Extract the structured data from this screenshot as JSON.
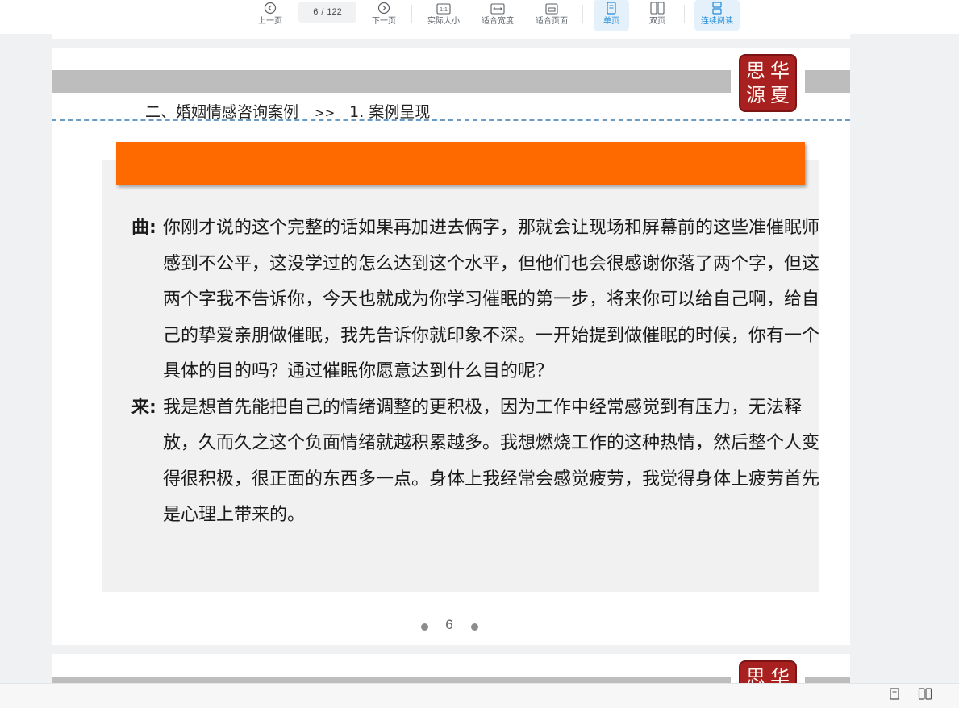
{
  "toolbar": {
    "prev_label": "上一页",
    "current_page": "6",
    "page_separator": "/",
    "total_pages": "122",
    "next_label": "下一页",
    "actual_size_label": "实际大小",
    "fit_width_label": "适合宽度",
    "fit_page_label": "适合页面",
    "single_page_label": "单页",
    "double_page_label": "双页",
    "continuous_label": "连续阅读",
    "active_mode": "single-page",
    "accent_color": "#1e8ad8"
  },
  "page": {
    "section": "二、婚姻情感咨询案例",
    "breadcrumb_arrow": ">>",
    "subsection": "1. 案例呈现",
    "seal_chars": [
      "思",
      "华",
      "源",
      "夏"
    ],
    "seal_color": "#a8201f",
    "banner_color": "#ff6a00",
    "dialog": [
      {
        "speaker": "曲:",
        "text": "你刚才说的这个完整的话如果再加进去俩字，那就会让现场和屏幕前的这些准催眠师感到不公平，这没学过的怎么达到这个水平，但他们也会很感谢你落了两个字，但这两个字我不告诉你，今天也就成为你学习催眠的第一步，将来你可以给自己啊，给自己的挚爱亲朋做催眠，我先告诉你就印象不深。一开始提到做催眠的时候，你有一个具体的目的吗？通过催眠你愿意达到什么目的呢？"
      },
      {
        "speaker": "来:",
        "text": "我是想首先能把自己的情绪调整的更积极，因为工作中经常感觉到有压力，无法释放，久而久之这个负面情绪就越积累越多。我想燃烧工作的这种热情，然后整个人变得很积极，很正面的东西多一点。身体上我经常会感觉疲劳，我觉得身体上疲劳首先是心理上带来的。"
      }
    ],
    "page_number": "6"
  },
  "statusbar": {
    "icons": [
      "single-page-view-icon",
      "double-page-view-icon"
    ]
  }
}
